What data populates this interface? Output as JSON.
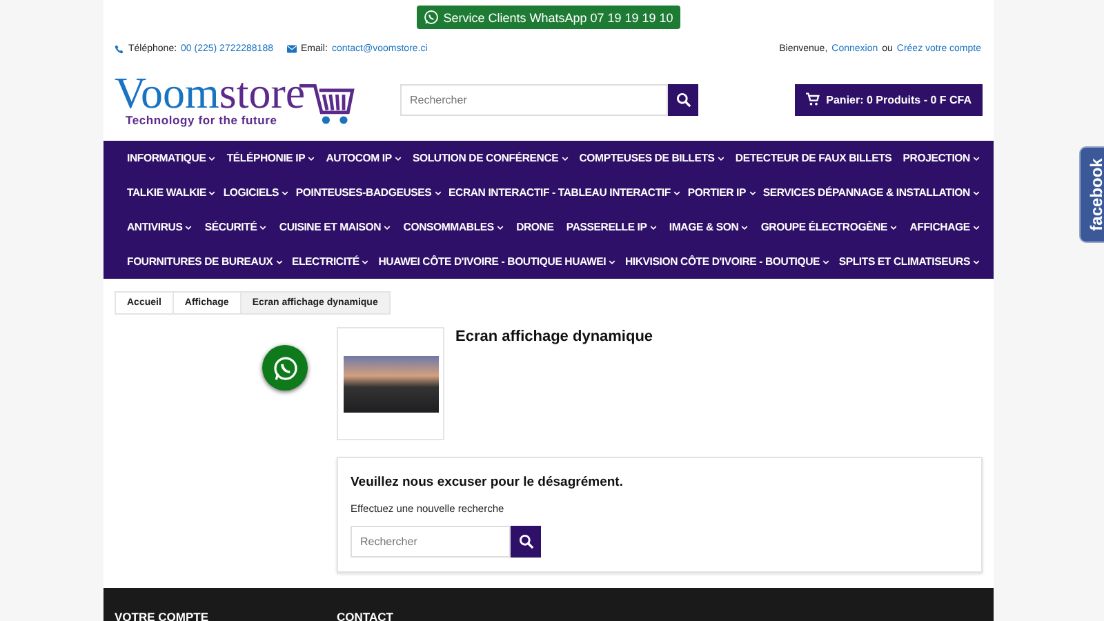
{
  "whatsapp_banner": {
    "label": "Service Clients WhatsApp 07 19 19 19 10"
  },
  "contact_bar": {
    "phone_label": "Téléphone:",
    "phone": "00 (225) 2722288188",
    "email_label": "Email:",
    "email": "contact@voomstore.ci",
    "welcome": "Bienvenue,",
    "login": "Connexion",
    "or": "ou",
    "register": "Créez votre compte"
  },
  "logo": {
    "name": "Voomstore",
    "tagline": "Technology for the future"
  },
  "search": {
    "placeholder": "Rechercher"
  },
  "cart": {
    "label": "Panier: 0 Produits - 0 F CFA"
  },
  "menu": [
    {
      "items": [
        {
          "label": "INFORMATIQUE",
          "has_submenu": true
        },
        {
          "label": "TÉLÉPHONIE IP",
          "has_submenu": true
        },
        {
          "label": "AUTOCOM IP",
          "has_submenu": true
        },
        {
          "label": "SOLUTION DE CONFÉRENCE",
          "has_submenu": true
        },
        {
          "label": "COMPTEUSES DE BILLETS",
          "has_submenu": true
        },
        {
          "label": "DETECTEUR DE FAUX BILLETS",
          "has_submenu": false
        },
        {
          "label": "PROJECTION",
          "has_submenu": true
        }
      ]
    },
    {
      "items": [
        {
          "label": "TALKIE WALKIE",
          "has_submenu": true
        },
        {
          "label": "LOGICIELS",
          "has_submenu": true
        },
        {
          "label": "POINTEUSES-BADGEUSES",
          "has_submenu": true
        },
        {
          "label": "ECRAN INTERACTIF - TABLEAU INTERACTIF",
          "has_submenu": true
        },
        {
          "label": "PORTIER IP",
          "has_submenu": true
        },
        {
          "label": "SERVICES DÉPANNAGE & INSTALLATION",
          "has_submenu": true
        }
      ]
    },
    {
      "items": [
        {
          "label": "ANTIVIRUS",
          "has_submenu": true
        },
        {
          "label": "SÉCURITÉ",
          "has_submenu": true
        },
        {
          "label": "CUISINE ET MAISON",
          "has_submenu": true
        },
        {
          "label": "CONSOMMABLES",
          "has_submenu": true
        },
        {
          "label": "DRONE",
          "has_submenu": false
        },
        {
          "label": "PASSERELLE IP",
          "has_submenu": true
        },
        {
          "label": "IMAGE & SON",
          "has_submenu": true
        },
        {
          "label": "GROUPE ÉLECTROGÈNE",
          "has_submenu": true
        },
        {
          "label": "AFFICHAGE",
          "has_submenu": true
        }
      ]
    },
    {
      "items": [
        {
          "label": "FOURNITURES DE BUREAUX",
          "has_submenu": true
        },
        {
          "label": "ELECTRICITÉ",
          "has_submenu": true
        },
        {
          "label": "HUAWEI CÔTE D'IVOIRE - BOUTIQUE HUAWEI",
          "has_submenu": true
        },
        {
          "label": "HIKVISION CÔTE D'IVOIRE - BOUTIQUE",
          "has_submenu": true
        },
        {
          "label": "SPLITS ET CLIMATISEURS",
          "has_submenu": true
        }
      ]
    }
  ],
  "breadcrumb": [
    {
      "label": "Accueil",
      "current": false
    },
    {
      "label": "Affichage",
      "current": false
    },
    {
      "label": "Ecran affichage dynamique",
      "current": true
    }
  ],
  "category": {
    "title": "Ecran affichage dynamique"
  },
  "not_found": {
    "title": "Veuillez nous excuser pour le désagrément.",
    "text": "Effectuez une nouvelle recherche",
    "search_placeholder": "Rechercher"
  },
  "footer": {
    "columns": [
      "VOTRE COMPTE",
      "CONTACT"
    ]
  },
  "facebook_tab": {
    "label": "facebook"
  }
}
